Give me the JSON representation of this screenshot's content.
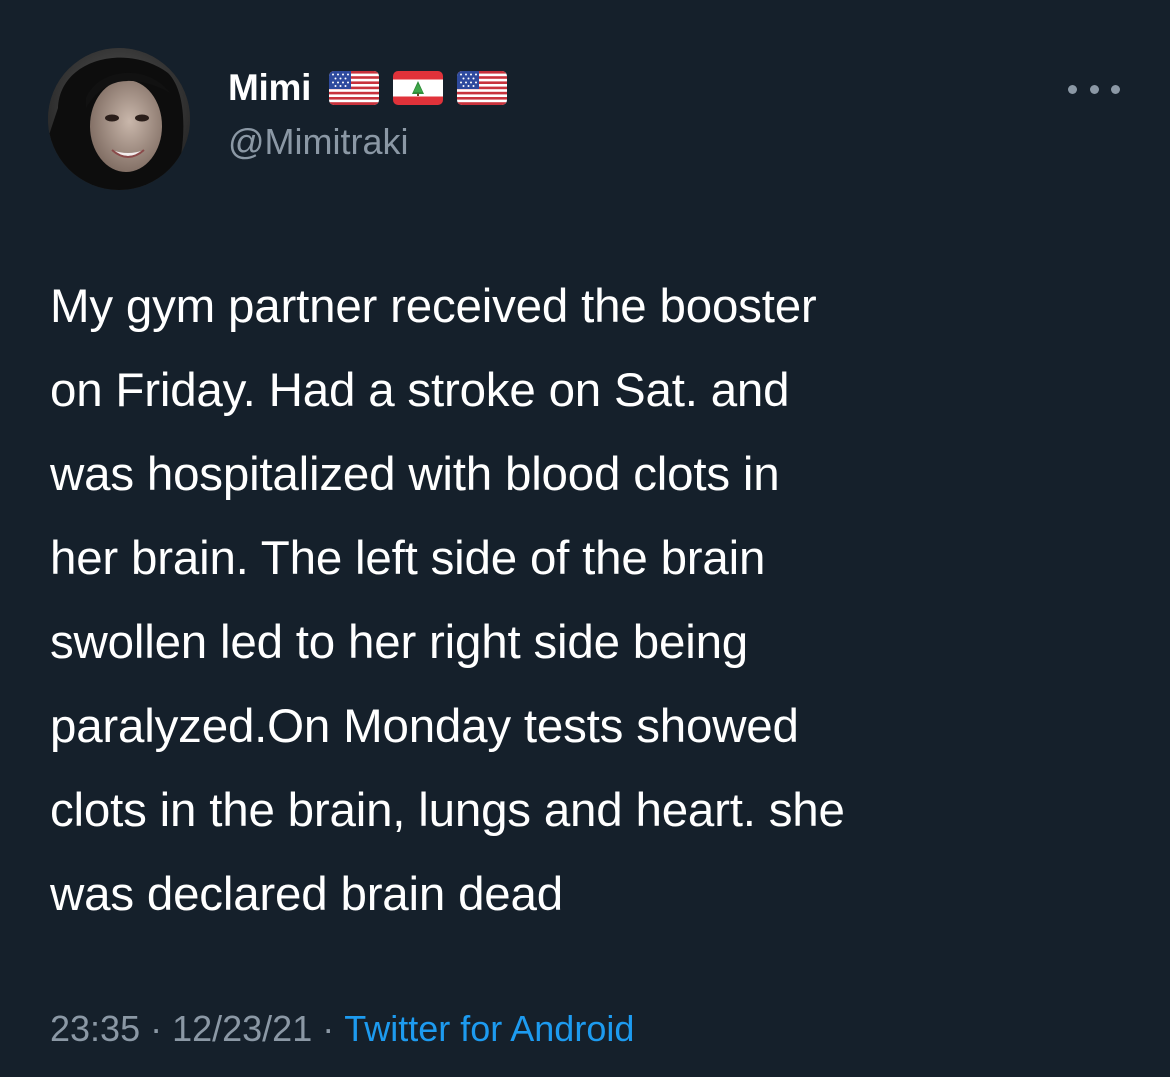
{
  "user": {
    "display_name": "Mimi",
    "handle": "@Mimitraki",
    "avatar_icon": "profile-photo",
    "flags": [
      "us-flag-icon",
      "lebanon-flag-icon",
      "us-flag-icon"
    ]
  },
  "menu": {
    "more_icon": "more-dots-icon"
  },
  "tweet": {
    "lines": [
      "My gym partner received the booster",
      "on Friday. Had a stroke on Sat. and",
      "was hospitalized with blood clots in",
      "her brain. The left side of the brain",
      "swollen led to her right side being",
      "paralyzed.On Monday tests showed",
      "clots in the brain, lungs and heart. she",
      "was declared brain dead"
    ]
  },
  "meta": {
    "time": "23:35",
    "separator": "·",
    "date": "12/23/21",
    "source": "Twitter for Android"
  },
  "colors": {
    "background": "#15202b",
    "text_primary": "#ffffff",
    "text_secondary": "#8b98a5",
    "link": "#1d9bf0"
  }
}
